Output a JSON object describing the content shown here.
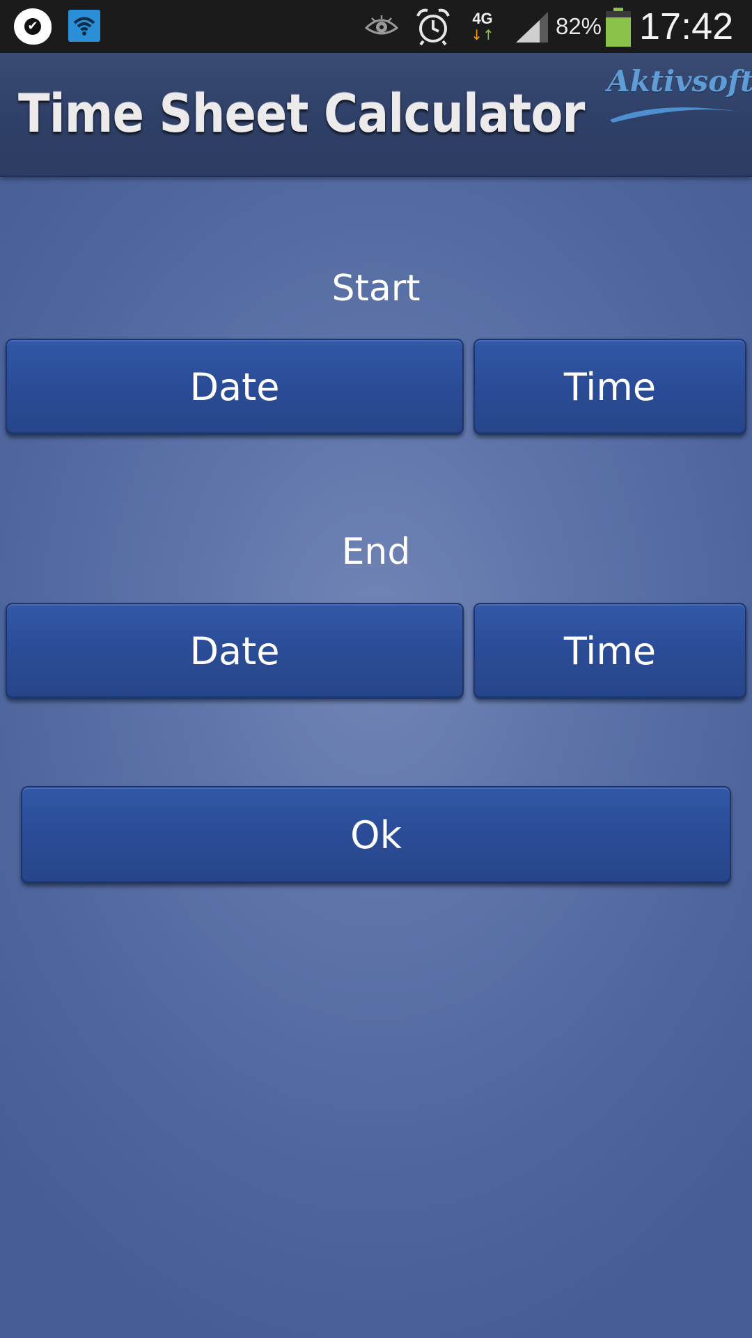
{
  "status_bar": {
    "battery_percent": "82%",
    "time": "17:42",
    "network_type": "4G",
    "battery_level": 0.82,
    "icons": [
      "check-notification-icon",
      "wifi-notification-icon",
      "eye-icon",
      "alarm-icon",
      "network-4g-icon",
      "signal-icon",
      "battery-icon"
    ]
  },
  "header": {
    "title": "Time Sheet  Calculator",
    "brand": "Aktivsoft"
  },
  "start": {
    "label": "Start",
    "date_button": "Date",
    "time_button": "Time"
  },
  "end": {
    "label": "End",
    "date_button": "Date",
    "time_button": "Time"
  },
  "ok_button": "Ok",
  "colors": {
    "background": "#5f75aa",
    "header": "#2f4068",
    "button": "#2b4d98",
    "battery": "#8bc34a"
  }
}
